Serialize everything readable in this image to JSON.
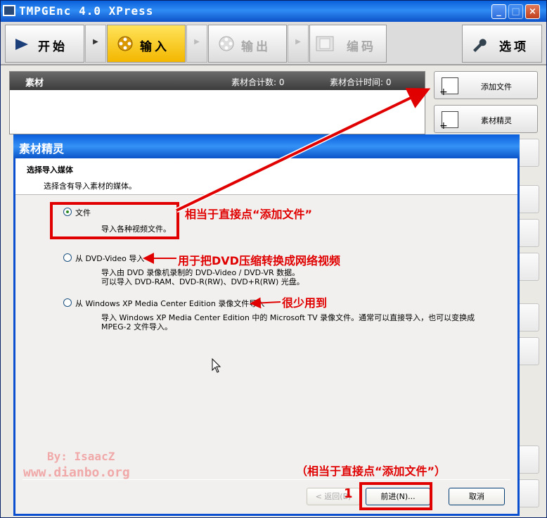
{
  "window": {
    "title": "TMPGEnc 4.0 XPress"
  },
  "toolbar": {
    "start": "开始",
    "input": "输入",
    "output": "输出",
    "encode": "编码",
    "options": "选项",
    "arrow": "▶"
  },
  "material": {
    "title": "素材",
    "count_label": "素材合计数: 0",
    "time_label": "素材合计时间: 0"
  },
  "side": {
    "add_file": "添加文件",
    "wizard": "素材精灵"
  },
  "wizard": {
    "title": "素材精灵",
    "heading": "选择导入媒体",
    "subheading": "选择含有导入素材的媒体。",
    "options": [
      {
        "label": "文件",
        "desc": [
          "导入各种视频文件。"
        ],
        "selected": true
      },
      {
        "label": "从 DVD-Video 导入",
        "desc": [
          "导入由 DVD 录像机录制的 DVD-Video / DVD-VR 数据。",
          "可以导入 DVD-RAM、DVD-R(RW)、DVD+R(RW) 光盘。"
        ],
        "selected": false
      },
      {
        "label": "从 Windows XP Media Center Edition 录像文件导入",
        "desc": [
          "导入 Windows XP Media Center Edition 中的 Microsoft TV 录像文件。通常可以直接导入，也可以变换成",
          "MPEG-2 文件导入。"
        ],
        "selected": false
      }
    ],
    "buttons": {
      "back": "< 返回(B)",
      "next": "前进(N)...",
      "cancel": "取消"
    }
  },
  "annotations": {
    "a1": "相当于直接点“添加文件”",
    "a2": "用于把DVD压缩转换成网络视频",
    "a3": "很少用到",
    "a4": "（相当于直接点“添加文件”）",
    "step": "1"
  },
  "watermark": {
    "line1": "By: IsaacZ",
    "line2": "www.dianbo.org"
  },
  "colors": {
    "annotation": "#e00000",
    "accent": "#0a5fd9",
    "active_tab": "#f3b700"
  }
}
